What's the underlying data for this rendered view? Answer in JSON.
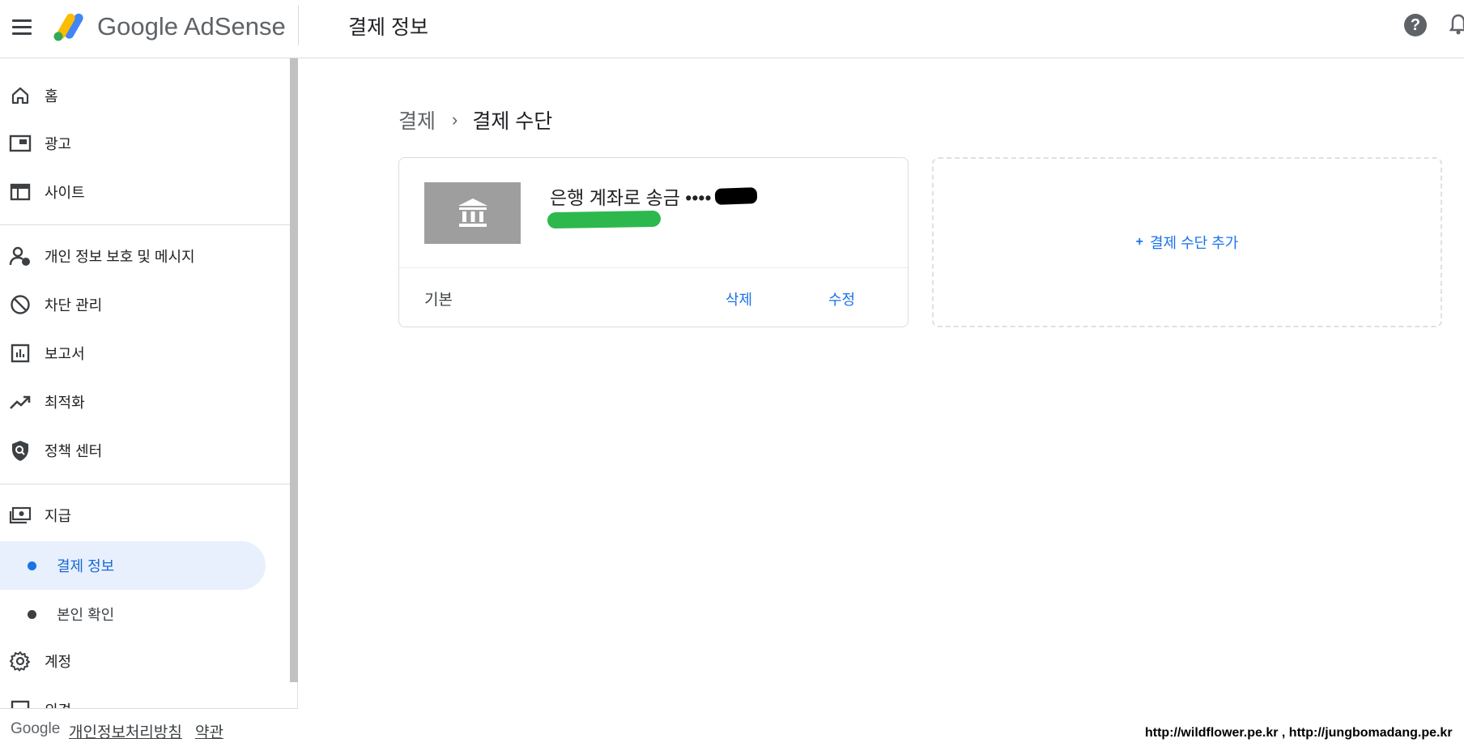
{
  "header": {
    "app_name": "Google AdSense",
    "page_title": "결제 정보"
  },
  "sidebar": {
    "items": [
      {
        "label": "홈",
        "icon": "home-icon"
      },
      {
        "label": "광고",
        "icon": "ads-icon"
      },
      {
        "label": "사이트",
        "icon": "sites-icon"
      },
      {
        "label": "개인 정보 보호 및 메시지",
        "icon": "privacy-messaging-icon"
      },
      {
        "label": "차단 관리",
        "icon": "block-icon"
      },
      {
        "label": "보고서",
        "icon": "reports-icon"
      },
      {
        "label": "최적화",
        "icon": "optimization-icon"
      },
      {
        "label": "정책 센터",
        "icon": "policy-center-icon"
      },
      {
        "label": "지급",
        "icon": "payments-icon"
      },
      {
        "label": "계정",
        "icon": "gear-icon"
      },
      {
        "label": "의견",
        "icon": "feedback-icon"
      }
    ],
    "sub_items": [
      {
        "label": "결제 정보",
        "active": true
      },
      {
        "label": "본인 확인",
        "active": false
      }
    ],
    "footer": {
      "brand": "Google",
      "privacy_link": "개인정보처리방침",
      "terms_link": "약관"
    }
  },
  "breadcrumb": {
    "parent": "결제",
    "current": "결제 수단"
  },
  "payment_method": {
    "name": "은행 계좌로 송금 ••••",
    "status": "기본",
    "delete_label": "삭제",
    "edit_label": "수정"
  },
  "add_payment": {
    "label": "결제 수단 추가"
  },
  "watermark": "http://wildflower.pe.kr , http://jungbomadang.pe.kr",
  "colors": {
    "accent": "#1a73e8",
    "active_bg": "#e8f0fe",
    "redaction_green": "#2db84d"
  }
}
